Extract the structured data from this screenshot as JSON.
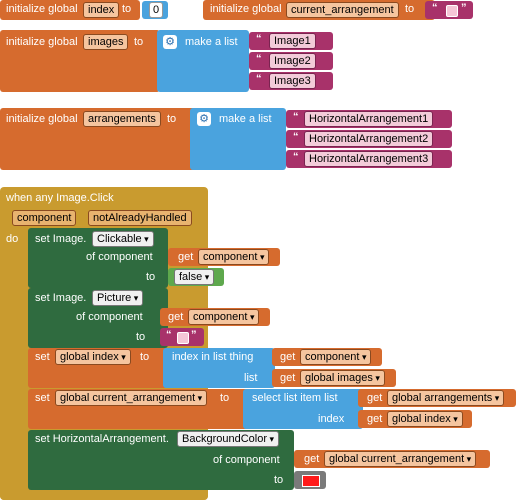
{
  "row1": {
    "init_label": "initialize global",
    "var_index": "index",
    "to": "to",
    "index_value": "0",
    "var_current": "current_arrangement",
    "quote": "“"
  },
  "row2": {
    "init_label": "initialize global",
    "var_images": "images",
    "to": "to",
    "make_list": "make a list",
    "items": [
      "Image1",
      "Image2",
      "Image3"
    ]
  },
  "row3": {
    "init_label": "initialize global",
    "var_arrangements": "arrangements",
    "to": "to",
    "make_list": "make a list",
    "items": [
      "HorizontalArrangement1",
      "HorizontalArrangement2",
      "HorizontalArrangement3"
    ]
  },
  "event": {
    "title": "when any Image.Click",
    "param1": "component",
    "param2": "notAlreadyHandled",
    "do": "do",
    "s1_set": "set Image.",
    "s1_prop": "Clickable",
    "s1_of": "of component",
    "s1_get": "get",
    "s1_getvar": "component",
    "s1_to": "to",
    "s1_value": "false",
    "s2_set": "set Image.",
    "s2_prop": "Picture",
    "s2_of": "of component",
    "s2_get": "get",
    "s2_getvar": "component",
    "s2_to": "to",
    "s3_set": "set",
    "s3_var": "global index",
    "s3_to": "to",
    "s3_fn": "index in list  thing",
    "s3_get1": "get",
    "s3_getvar1": "component",
    "s3_list": "list",
    "s3_get2": "get",
    "s3_getvar2": "global images",
    "s4_set": "set",
    "s4_var": "global current_arrangement",
    "s4_to": "to",
    "s4_fn": "select list item  list",
    "s4_get1": "get",
    "s4_getvar1": "global arrangements",
    "s4_index": "index",
    "s4_get2": "get",
    "s4_getvar2": "global index",
    "s5_set": "set HorizontalArrangement.",
    "s5_prop": "BackgroundColor",
    "s5_of": "of component",
    "s5_get": "get",
    "s5_getvar": "global current_arrangement",
    "s5_to": "to"
  },
  "colors": {
    "variable_orange": "#d66b2e",
    "list_blue": "#4aa3de",
    "text_purple": "#a8326a",
    "component_green": "#2f6b3f",
    "logic_green": "#5ea84d",
    "event_gold": "#c99b2f",
    "color_red": "#ff1a1a"
  }
}
